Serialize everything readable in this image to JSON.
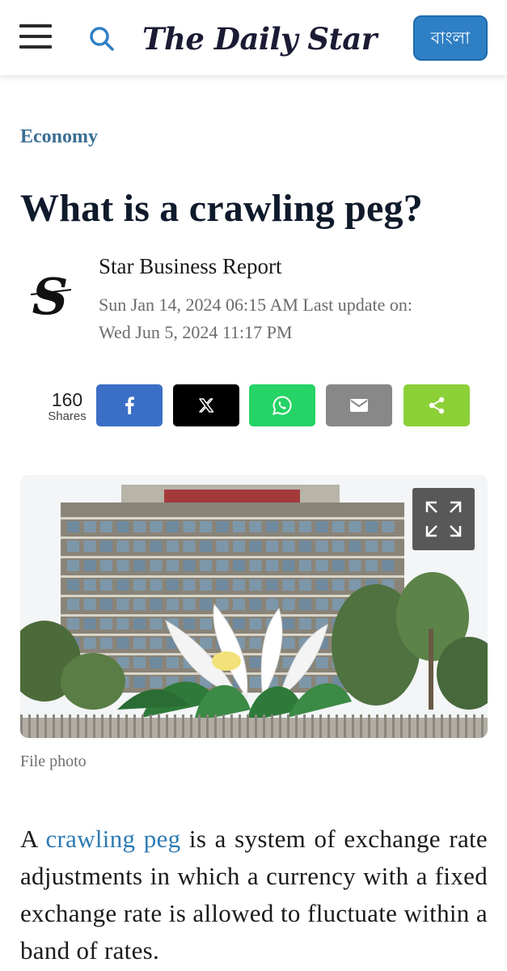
{
  "header": {
    "logo_text": "The Daily Star",
    "lang_button": "বাংলা"
  },
  "article": {
    "category": "Economy",
    "title": "What is a crawling peg?",
    "author": "Star Business Report",
    "published": "Sun Jan 14, 2024 06:15 AM Last update on:",
    "updated": "Wed Jun 5, 2024 11:17 PM",
    "shares": {
      "count": "160",
      "label": "Shares"
    },
    "share_buttons": [
      {
        "name": "facebook",
        "color": "#3b6fc5"
      },
      {
        "name": "x",
        "color": "#000000"
      },
      {
        "name": "whatsapp",
        "color": "#25d366"
      },
      {
        "name": "email",
        "color": "#888888"
      },
      {
        "name": "share",
        "color": "#8cd038"
      }
    ],
    "image_caption": "File photo",
    "lead": {
      "prefix": "A ",
      "link": "crawling peg",
      "suffix": " is a system of exchange rate adjustments in which a currency with a fixed exchange rate is allowed to fluctuate within a band of rates."
    }
  },
  "colors": {
    "accent": "#2f7fc4",
    "category": "#3a6f94",
    "link": "#2e7bb4"
  }
}
